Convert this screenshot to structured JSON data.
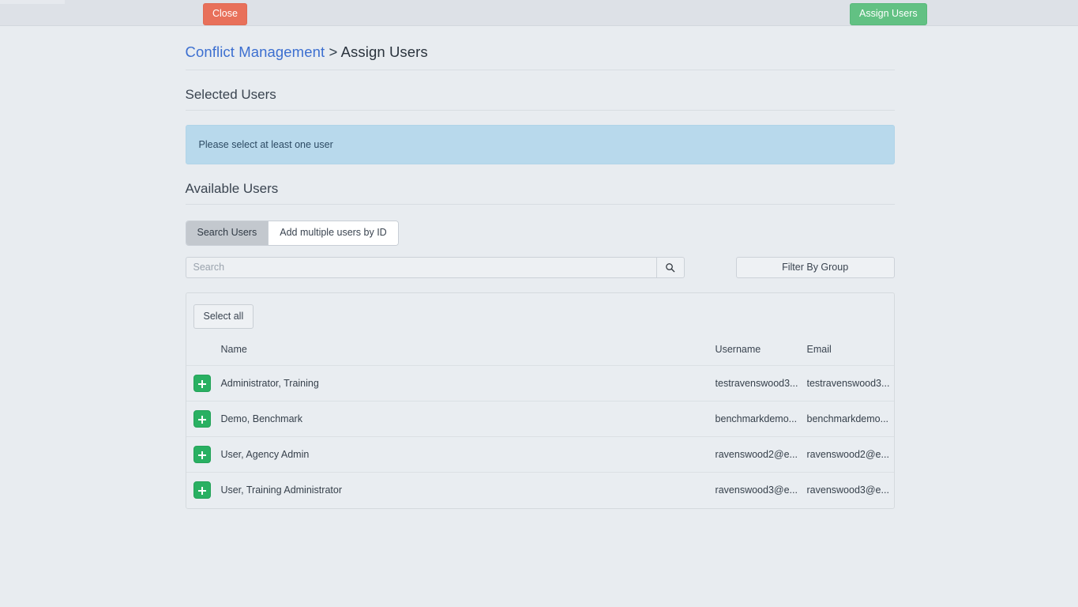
{
  "topbar": {
    "close_label": "Close",
    "assign_label": "Assign Users",
    "close_color": "#e8705a",
    "assign_color": "#62c183"
  },
  "breadcrumb": {
    "root_label": "Conflict Management",
    "separator": ">",
    "current_label": "Assign Users"
  },
  "selected_users": {
    "title": "Selected Users",
    "alert_message": "Please select at least one user",
    "alert_color": "#b8d9ec"
  },
  "available_users": {
    "title": "Available Users",
    "tabs": [
      {
        "label": "Search Users",
        "active": true
      },
      {
        "label": "Add multiple users by ID",
        "active": false
      }
    ],
    "search": {
      "placeholder": "Search",
      "value": "",
      "search_icon": "search-icon"
    },
    "filter_button_label": "Filter By Group",
    "select_all_label": "Select all",
    "table": {
      "columns": [
        "",
        "Name",
        "Username",
        "Email"
      ],
      "rows": [
        {
          "action_icon": "plus-icon",
          "name": "Administrator, Training",
          "username": "testravenswood3...",
          "email": "testravenswood3..."
        },
        {
          "action_icon": "plus-icon",
          "name": "Demo, Benchmark",
          "username": "benchmarkdemo...",
          "email": "benchmarkdemo..."
        },
        {
          "action_icon": "plus-icon",
          "name": "User, Agency Admin",
          "username": "ravenswood2@e...",
          "email": "ravenswood2@e..."
        },
        {
          "action_icon": "plus-icon",
          "name": "User, Training Administrator",
          "username": "ravenswood3@e...",
          "email": "ravenswood3@e..."
        }
      ]
    }
  }
}
